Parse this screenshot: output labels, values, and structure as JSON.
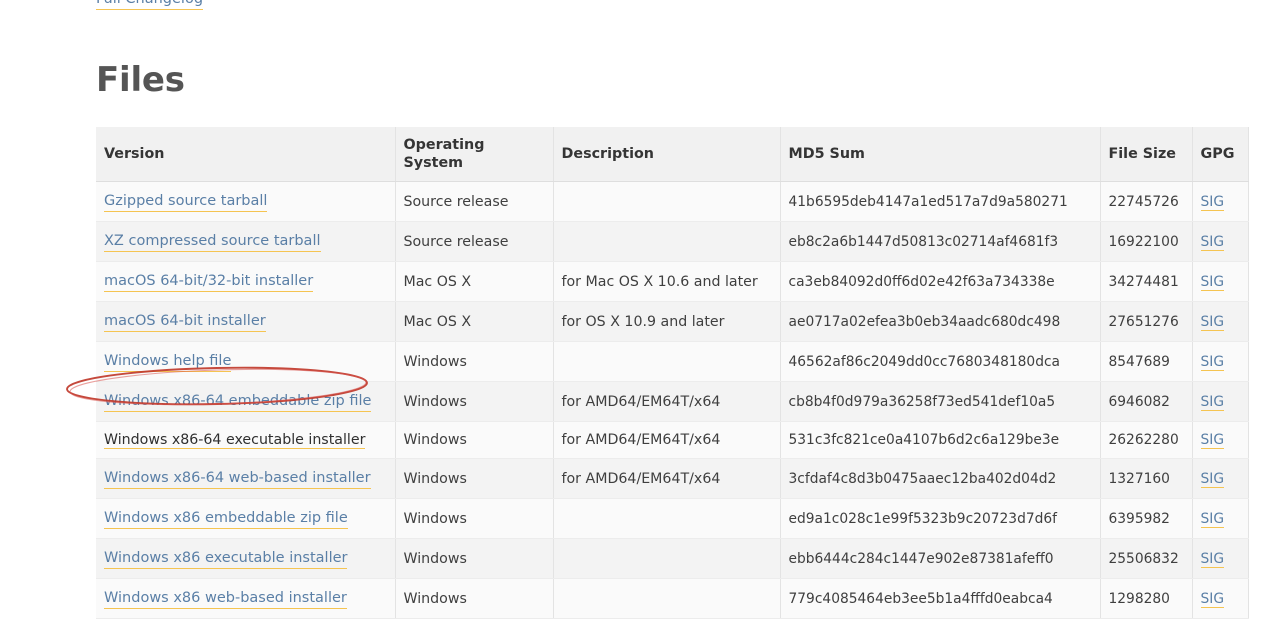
{
  "top_link": {
    "label": "Full Changelog"
  },
  "heading": {
    "title": "Files"
  },
  "table": {
    "columns": [
      "Version",
      "Operating System",
      "Description",
      "MD5 Sum",
      "File Size",
      "GPG"
    ],
    "gpg_label": "SIG",
    "rows": [
      {
        "version": "Gzipped source tarball",
        "os": "Source release",
        "description": "",
        "md5": "41b6595deb4147a1ed517a7d9a580271",
        "size": "22745726",
        "gpg": "SIG",
        "is_link": true,
        "annotated": false
      },
      {
        "version": "XZ compressed source tarball",
        "os": "Source release",
        "description": "",
        "md5": "eb8c2a6b1447d50813c02714af4681f3",
        "size": "16922100",
        "gpg": "SIG",
        "is_link": true,
        "annotated": false
      },
      {
        "version": "macOS 64-bit/32-bit installer",
        "os": "Mac OS X",
        "description": "for Mac OS X 10.6 and later",
        "md5": "ca3eb84092d0ff6d02e42f63a734338e",
        "size": "34274481",
        "gpg": "SIG",
        "is_link": true,
        "annotated": false
      },
      {
        "version": "macOS 64-bit installer",
        "os": "Mac OS X",
        "description": "for OS X 10.9 and later",
        "md5": "ae0717a02efea3b0eb34aadc680dc498",
        "size": "27651276",
        "gpg": "SIG",
        "is_link": true,
        "annotated": false
      },
      {
        "version": "Windows help file",
        "os": "Windows",
        "description": "",
        "md5": "46562af86c2049dd0cc7680348180dca",
        "size": "8547689",
        "gpg": "SIG",
        "is_link": true,
        "annotated": false
      },
      {
        "version": "Windows x86-64 embeddable zip file",
        "os": "Windows",
        "description": "for AMD64/EM64T/x64",
        "md5": "cb8b4f0d979a36258f73ed541def10a5",
        "size": "6946082",
        "gpg": "SIG",
        "is_link": true,
        "annotated": false
      },
      {
        "version": "Windows x86-64 executable installer",
        "os": "Windows",
        "description": "for AMD64/EM64T/x64",
        "md5": "531c3fc821ce0a4107b6d2c6a129be3e",
        "size": "26262280",
        "gpg": "SIG",
        "is_link": false,
        "annotated": true
      },
      {
        "version": "Windows x86-64 web-based installer",
        "os": "Windows",
        "description": "for AMD64/EM64T/x64",
        "md5": "3cfdaf4c8d3b0475aaec12ba402d04d2",
        "size": "1327160",
        "gpg": "SIG",
        "is_link": true,
        "annotated": false
      },
      {
        "version": "Windows x86 embeddable zip file",
        "os": "Windows",
        "description": "",
        "md5": "ed9a1c028c1e99f5323b9c20723d7d6f",
        "size": "6395982",
        "gpg": "SIG",
        "is_link": true,
        "annotated": false
      },
      {
        "version": "Windows x86 executable installer",
        "os": "Windows",
        "description": "",
        "md5": "ebb6444c284c1447e902e87381afeff0",
        "size": "25506832",
        "gpg": "SIG",
        "is_link": true,
        "annotated": false
      },
      {
        "version": "Windows x86 web-based installer",
        "os": "Windows",
        "description": "",
        "md5": "779c4085464eb3ee5b1a4fffd0eabca4",
        "size": "1298280",
        "gpg": "SIG",
        "is_link": true,
        "annotated": false
      }
    ]
  },
  "annotation": {
    "shape": "ellipse",
    "color": "#c0392b",
    "targets_row_version": "Windows x86-64 executable installer"
  },
  "colors": {
    "link": "#5a7fa6",
    "link_underline": "#f5c451",
    "heading": "#555555",
    "header_bg": "#f1f1f1",
    "row_odd_bg": "#fafafa",
    "row_even_bg": "#f3f3f3",
    "annotation_red": "#c0392b"
  }
}
